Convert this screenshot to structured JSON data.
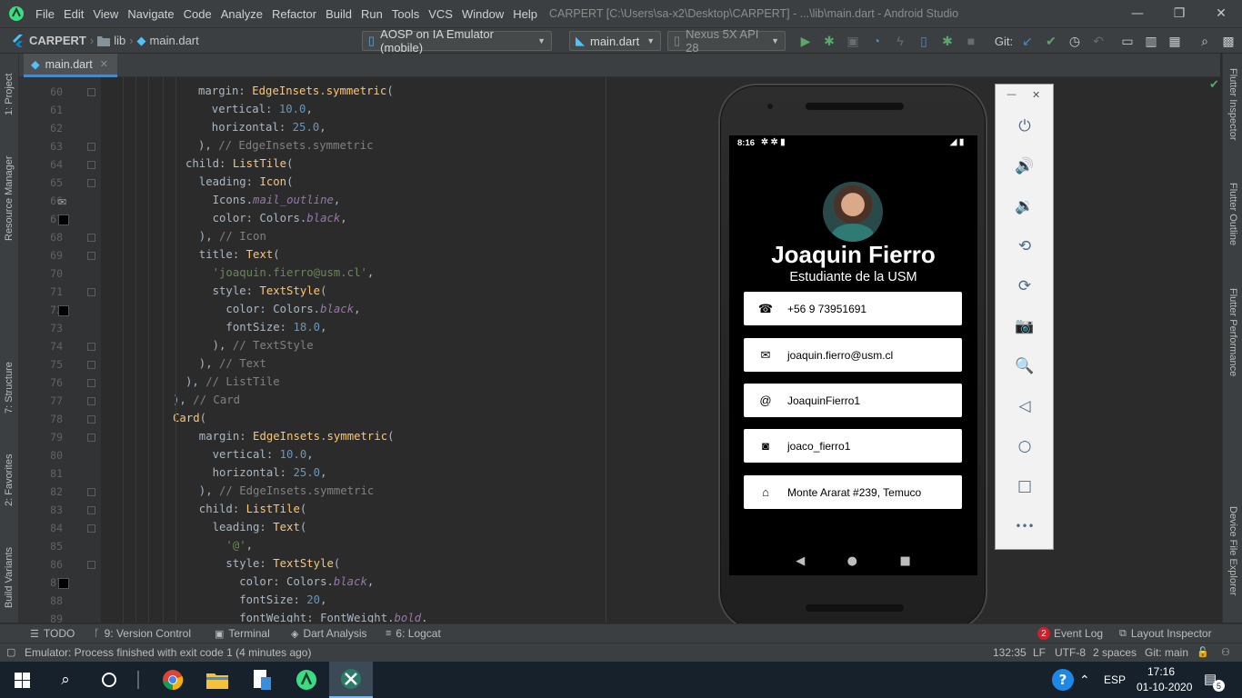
{
  "window": {
    "menus": [
      "File",
      "Edit",
      "View",
      "Navigate",
      "Code",
      "Analyze",
      "Refactor",
      "Build",
      "Run",
      "Tools",
      "VCS",
      "Window",
      "Help"
    ],
    "title": "CARPERT [C:\\Users\\sa-x2\\Desktop\\CARPERT] - ...\\lib\\main.dart - Android Studio",
    "min": "—",
    "max": "❐",
    "close": "✕"
  },
  "toolbar": {
    "breadcrumb": [
      "CARPERT",
      "lib",
      "main.dart"
    ],
    "device": "AOSP on IA Emulator (mobile)",
    "config": "main.dart",
    "avd": "Nexus 5X API 28",
    "git_label": "Git:"
  },
  "tabs": {
    "main": "main.dart"
  },
  "left_tools": [
    "1: Project",
    "Resource Manager",
    "7: Structure",
    "2: Favorites",
    "Build Variants"
  ],
  "right_tools": [
    "Flutter Inspector",
    "Flutter Outline",
    "Flutter Performance",
    "Device File Explorer"
  ],
  "code": {
    "line_numbers": [
      "60",
      "61",
      "62",
      "63",
      "64",
      "65",
      "66",
      "67",
      "68",
      "69",
      "70",
      "71",
      "72",
      "73",
      "74",
      "75",
      "76",
      "77",
      "78",
      "79",
      "80",
      "81",
      "82",
      "83",
      "84",
      "85",
      "86",
      "87",
      "88",
      "89"
    ],
    "lines": [
      [
        [
          "pl",
          "margin: "
        ],
        [
          "cls",
          "EdgeInsets"
        ],
        [
          "pl",
          "."
        ],
        [
          "cls",
          "symmetric"
        ],
        [
          "pl",
          "("
        ]
      ],
      [
        [
          "pl",
          "  vertical: "
        ],
        [
          "num",
          "10.0"
        ],
        [
          "pl",
          ","
        ]
      ],
      [
        [
          "pl",
          "  horizontal: "
        ],
        [
          "num",
          "25.0"
        ],
        [
          "pl",
          ","
        ]
      ],
      [
        [
          "pl",
          "), "
        ],
        [
          "cmt",
          "// EdgeInsets.symmetric"
        ]
      ],
      [
        [
          "pl",
          "child: "
        ],
        [
          "cls",
          "ListTile"
        ],
        [
          "pl",
          "("
        ]
      ],
      [
        [
          "pl",
          "  leading: "
        ],
        [
          "cls",
          "Icon"
        ],
        [
          "pl",
          "("
        ]
      ],
      [
        [
          "pl",
          "    Icons."
        ],
        [
          "it",
          "mail_outline"
        ],
        [
          "pl",
          ","
        ]
      ],
      [
        [
          "pl",
          "    color: Colors."
        ],
        [
          "it",
          "black"
        ],
        [
          "pl",
          ","
        ]
      ],
      [
        [
          "pl",
          "  ), "
        ],
        [
          "cmt",
          "// Icon"
        ]
      ],
      [
        [
          "pl",
          "  title: "
        ],
        [
          "cls",
          "Text"
        ],
        [
          "pl",
          "("
        ]
      ],
      [
        [
          "str",
          "    'joaquin.fierro@usm.cl'"
        ],
        [
          "pl",
          ","
        ]
      ],
      [
        [
          "pl",
          "    style: "
        ],
        [
          "cls",
          "TextStyle"
        ],
        [
          "pl",
          "("
        ]
      ],
      [
        [
          "pl",
          "      color: Colors."
        ],
        [
          "it",
          "black"
        ],
        [
          "pl",
          ","
        ]
      ],
      [
        [
          "pl",
          "      fontSize: "
        ],
        [
          "num",
          "18.0"
        ],
        [
          "pl",
          ","
        ]
      ],
      [
        [
          "pl",
          "    ), "
        ],
        [
          "cmt",
          "// TextStyle"
        ]
      ],
      [
        [
          "pl",
          "  ), "
        ],
        [
          "cmt",
          "// Text"
        ]
      ],
      [
        [
          "pl",
          "), "
        ],
        [
          "cmt",
          "// ListTile"
        ]
      ],
      [
        [
          "pl",
          "), "
        ],
        [
          "cmt",
          "// Card"
        ]
      ],
      [
        [
          "cls",
          "Card"
        ],
        [
          "pl",
          "("
        ]
      ],
      [
        [
          "pl",
          "  margin: "
        ],
        [
          "cls",
          "EdgeInsets"
        ],
        [
          "pl",
          "."
        ],
        [
          "cls",
          "symmetric"
        ],
        [
          "pl",
          "("
        ]
      ],
      [
        [
          "pl",
          "    vertical: "
        ],
        [
          "num",
          "10.0"
        ],
        [
          "pl",
          ","
        ]
      ],
      [
        [
          "pl",
          "    horizontal: "
        ],
        [
          "num",
          "25.0"
        ],
        [
          "pl",
          ","
        ]
      ],
      [
        [
          "pl",
          "  ), "
        ],
        [
          "cmt",
          "// EdgeInsets.symmetric"
        ]
      ],
      [
        [
          "pl",
          "  child: "
        ],
        [
          "cls",
          "ListTile"
        ],
        [
          "pl",
          "("
        ]
      ],
      [
        [
          "pl",
          "    leading: "
        ],
        [
          "cls",
          "Text"
        ],
        [
          "pl",
          "("
        ]
      ],
      [
        [
          "str",
          "      '@'"
        ],
        [
          "pl",
          ","
        ]
      ],
      [
        [
          "pl",
          "      style: "
        ],
        [
          "cls",
          "TextStyle"
        ],
        [
          "pl",
          "("
        ]
      ],
      [
        [
          "pl",
          "        color: Colors."
        ],
        [
          "it",
          "black"
        ],
        [
          "pl",
          ","
        ]
      ],
      [
        [
          "pl",
          "        fontSize: "
        ],
        [
          "num",
          "20"
        ],
        [
          "pl",
          ","
        ]
      ],
      [
        [
          "pl",
          "        fontWeight: FontWeight."
        ],
        [
          "it",
          "bold"
        ],
        [
          "pl",
          "."
        ]
      ]
    ]
  },
  "emulator": {
    "status_time": "8:16",
    "name": "Joaquin Fierro",
    "subtitle": "Estudiante de la USM",
    "cards": [
      {
        "icon": "phone-icon",
        "glyph": "☎",
        "text": "+56 9 73951691"
      },
      {
        "icon": "mail-icon",
        "glyph": "✉",
        "text": "joaquin.fierro@usm.cl"
      },
      {
        "icon": "at-sign",
        "glyph": "@",
        "text": "JoaquinFierro1"
      },
      {
        "icon": "camera-icon",
        "glyph": "◙",
        "text": "joaco_fierro1"
      },
      {
        "icon": "home-icon",
        "glyph": "⌂",
        "text": "Monte Ararat #239, Temuco"
      }
    ],
    "nav": [
      "◀",
      "●",
      "■"
    ]
  },
  "emulator_controls": {
    "min": "—",
    "close": "✕",
    "buttons": [
      {
        "name": "power-icon",
        "glyph": "⏻"
      },
      {
        "name": "volume-up-icon",
        "glyph": "🔊"
      },
      {
        "name": "volume-down-icon",
        "glyph": "🔉"
      },
      {
        "name": "rotate-left-icon",
        "glyph": "⟲"
      },
      {
        "name": "rotate-right-icon",
        "glyph": "⟳"
      },
      {
        "name": "screenshot-icon",
        "glyph": "📷"
      },
      {
        "name": "zoom-icon",
        "glyph": "🔍"
      },
      {
        "name": "back-icon",
        "glyph": "◁"
      },
      {
        "name": "home-icon",
        "glyph": "○"
      },
      {
        "name": "overview-icon",
        "glyph": "□"
      },
      {
        "name": "more-icon",
        "glyph": "•••"
      }
    ]
  },
  "tool_windows": {
    "todo": "TODO",
    "vcs": "9: Version Control",
    "terminal": "Terminal",
    "dart": "Dart Analysis",
    "logcat": "6: Logcat",
    "event_log": "Event Log",
    "event_count": "2",
    "layout_inspector": "Layout Inspector"
  },
  "status": {
    "message": "Emulator: Process finished with exit code 1 (4 minutes ago)",
    "position": "132:35",
    "line_sep": "LF",
    "encoding": "UTF-8",
    "indent": "2 spaces",
    "branch": "Git: main"
  },
  "taskbar": {
    "lang": "ESP",
    "time": "17:16",
    "date": "01-10-2020",
    "notif_count": "5"
  },
  "colors": {
    "ide_bg": "#2b2b2b",
    "chrome": "#3c3f41",
    "accent": "#4a88c7",
    "run_green": "#59a869"
  }
}
